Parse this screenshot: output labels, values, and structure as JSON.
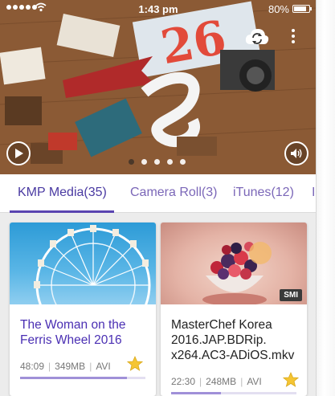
{
  "status_bar": {
    "time": "1:43 pm",
    "battery_percent": "80%"
  },
  "hero": {
    "slide_count": 5,
    "active_slide": 1,
    "icons": [
      "play-icon",
      "volume-icon",
      "sync-icon",
      "more-vertical-icon"
    ]
  },
  "tabs": [
    {
      "label": "KMP Media",
      "count": "(35)",
      "active": true
    },
    {
      "label": "Camera Roll",
      "count": "(3)",
      "active": false
    },
    {
      "label": "iTunes",
      "count": "(12)",
      "active": false
    },
    {
      "label": "I",
      "count": "",
      "active": false
    }
  ],
  "cards": [
    {
      "title": "The Woman on the Ferris Wheel 2016",
      "duration": "48:09",
      "size": "349MB",
      "format": "AVI",
      "favorite": true,
      "progress": 0.85,
      "badge": ""
    },
    {
      "title": "MasterChef Korea 2016.JAP.BDRip. x264.AC3-ADiOS.mkv",
      "duration": "22:30",
      "size": "248MB",
      "format": "AVI",
      "favorite": true,
      "progress": 0.4,
      "badge": "SMI"
    }
  ],
  "colors": {
    "accent": "#5a44b0",
    "tab_text": "#7b67b8",
    "star": "#f5c533"
  }
}
